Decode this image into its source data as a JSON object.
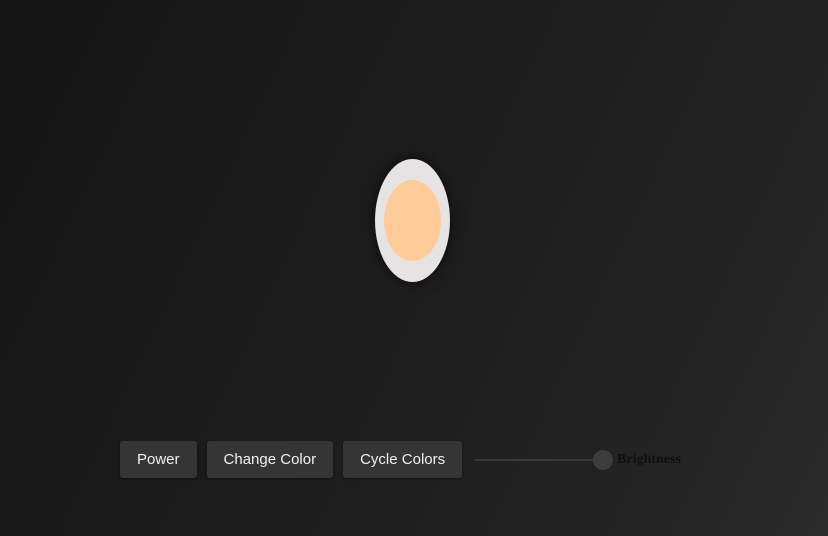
{
  "light": {
    "core_color": "#ffcc99",
    "shell_color": "#e6e4e2"
  },
  "controls": {
    "power_label": "Power",
    "change_color_label": "Change Color",
    "cycle_colors_label": "Cycle Colors",
    "brightness_label": "Brightness",
    "brightness_value": 1.0
  }
}
